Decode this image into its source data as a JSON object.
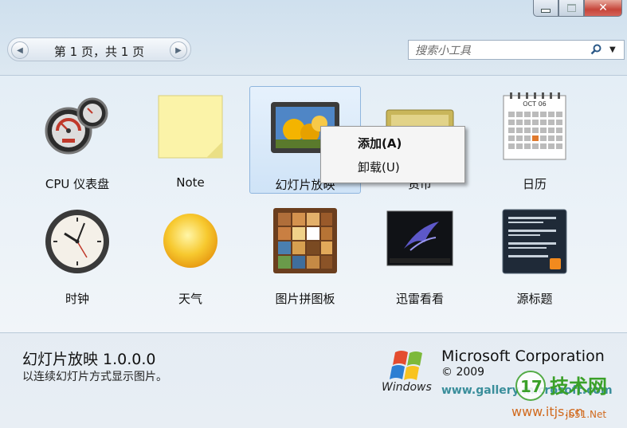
{
  "pager": {
    "text": "第 1 页，共 1 页"
  },
  "search": {
    "placeholder": "搜索小工具"
  },
  "gadgets": [
    {
      "label": "CPU 仪表盘",
      "icon": "cpu-meter-icon"
    },
    {
      "label": "Note",
      "icon": "note-icon"
    },
    {
      "label": "幻灯片放映",
      "icon": "slideshow-icon",
      "selected": true
    },
    {
      "label": "货币",
      "icon": "currency-icon"
    },
    {
      "label": "日历",
      "icon": "calendar-icon"
    },
    {
      "label": "时钟",
      "icon": "clock-icon"
    },
    {
      "label": "天气",
      "icon": "weather-icon"
    },
    {
      "label": "图片拼图板",
      "icon": "picture-puzzle-icon"
    },
    {
      "label": "迅雷看看",
      "icon": "xunlei-icon"
    },
    {
      "label": "源标题",
      "icon": "feed-headlines-icon"
    }
  ],
  "calendar": {
    "month": "OCT 06"
  },
  "context_menu": {
    "add": "添加(A)",
    "uninstall": "卸载(U)"
  },
  "details": {
    "name": "幻灯片放映 1.0.0.0",
    "description": "以连续幻灯片方式显示图片。",
    "publisher": "Microsoft Corporation",
    "copyright": "© 2009",
    "url": "www.gallery.microsoft.com",
    "windows_logo_text": "Windows"
  },
  "watermark": {
    "name": "技术网",
    "url": "www.itjs.cn",
    "site": "jb51.Net"
  },
  "colors": {
    "accent": "#8fb6de",
    "close_button": "#c6453a",
    "link": "#3a8e9b"
  }
}
